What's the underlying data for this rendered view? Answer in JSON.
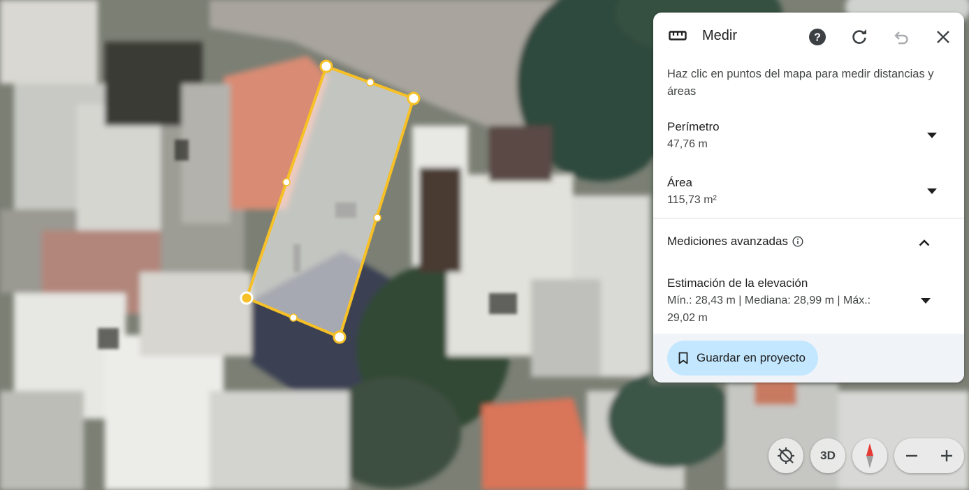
{
  "panel": {
    "title": "Medir",
    "description": "Haz clic en puntos del mapa para medir distancias y áreas",
    "perimeter": {
      "label": "Perímetro",
      "value": "47,76 m"
    },
    "area": {
      "label": "Área",
      "value": "115,73 m²"
    },
    "advanced": {
      "label": "Mediciones avanzadas"
    },
    "elevation": {
      "label": "Estimación de la elevación",
      "value": "Mín.: 28,43 m | Mediana: 28,99 m | Máx.: 29,02 m"
    },
    "save_label": "Guardar en proyecto"
  },
  "icons": {
    "ruler": "ruler-icon",
    "help": "help-icon",
    "refresh": "refresh-icon",
    "undo": "undo-icon",
    "close": "close-icon",
    "info": "info-icon",
    "bookmark": "bookmark-icon",
    "location": "location-off-icon",
    "compass": "compass-icon"
  },
  "map_controls": {
    "three_d_label": "3D"
  },
  "colors": {
    "accent": "#c2e7ff",
    "measure_line": "#f6c026"
  }
}
